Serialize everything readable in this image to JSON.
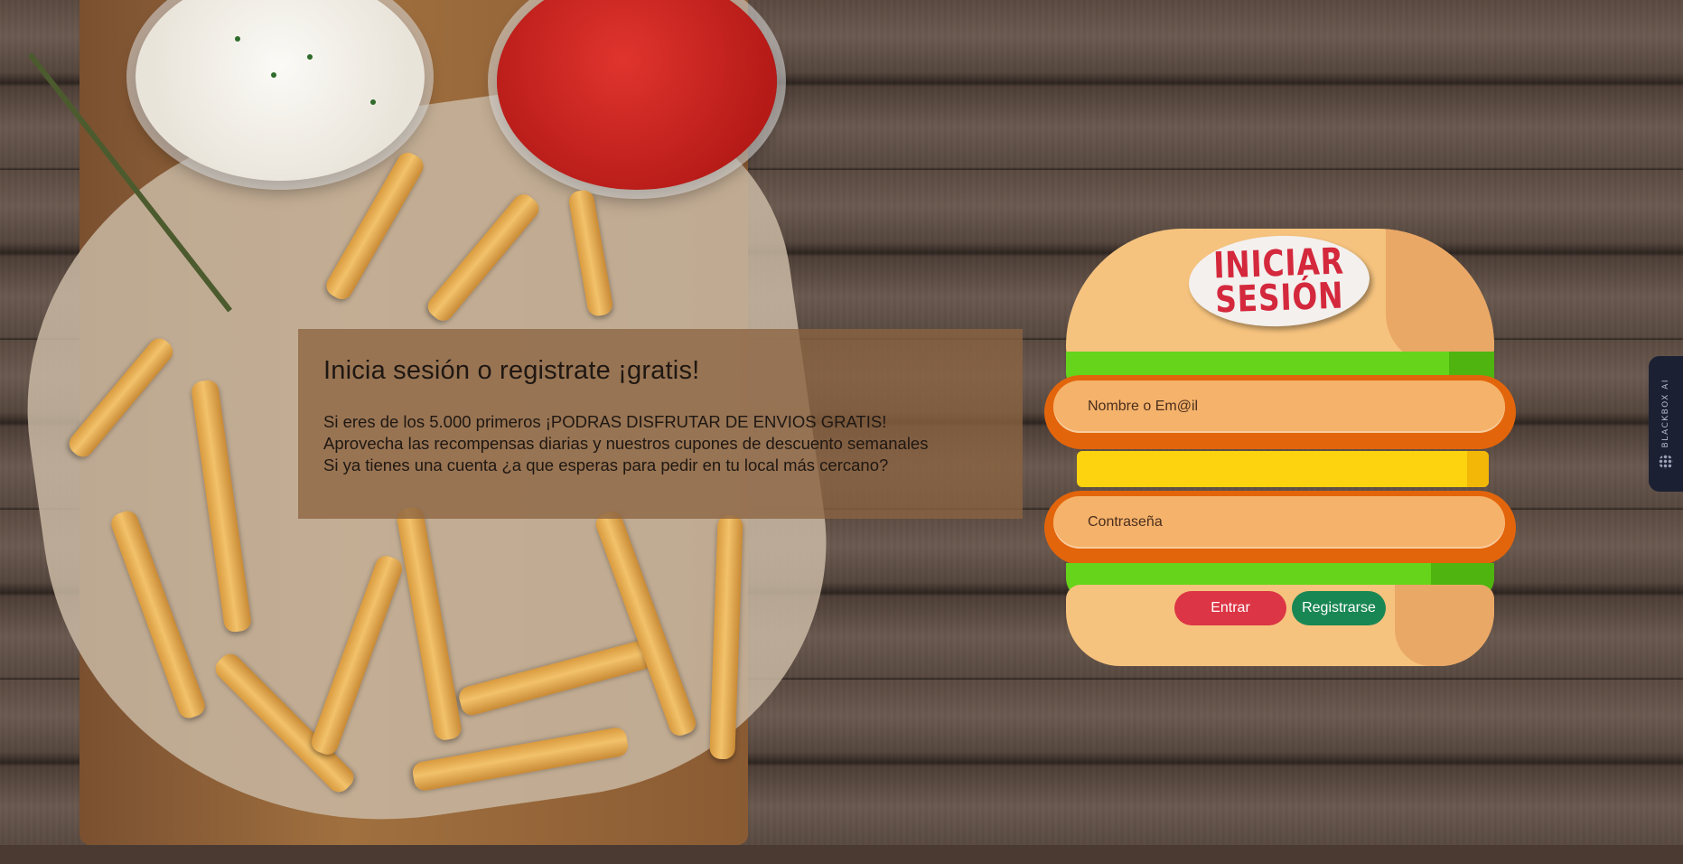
{
  "info": {
    "heading": "Inicia sesión o registrate ¡gratis!",
    "lines": [
      "Si eres de los 5.000 primeros ¡PODRAS DISFRUTAR DE ENVIOS GRATIS!",
      "Aprovecha las recompensas diarias y nuestros cupones de descuento semanales",
      "Si ya tienes una cuenta ¿a que esperas para pedir en tu local más cercano?"
    ]
  },
  "form": {
    "title_line1": "INICIAR",
    "title_line2": "SESIÓN",
    "username_placeholder": "Nombre o Em@il",
    "password_placeholder": "Contraseña",
    "login_label": "Entrar",
    "register_label": "Registrarse"
  },
  "side_widget": {
    "label": "BLACKBOX AI"
  },
  "colors": {
    "login_button": "#dc3545",
    "register_button": "#198754",
    "title_text": "#d4283c"
  }
}
